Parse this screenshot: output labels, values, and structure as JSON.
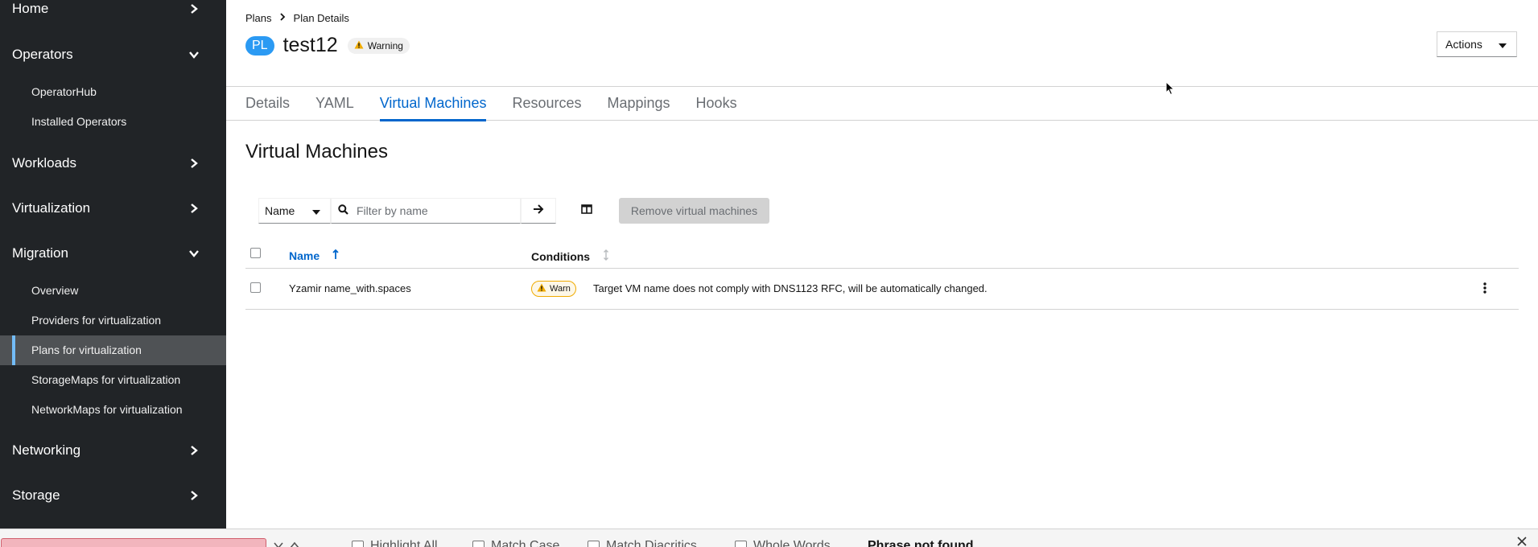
{
  "sidebar": {
    "items": [
      {
        "label": "Home",
        "expanded": false
      },
      {
        "label": "Operators",
        "expanded": true,
        "children": [
          "OperatorHub",
          "Installed Operators"
        ]
      },
      {
        "label": "Workloads",
        "expanded": false
      },
      {
        "label": "Virtualization",
        "expanded": false
      },
      {
        "label": "Migration",
        "expanded": true,
        "children": [
          "Overview",
          "Providers for virtualization",
          "Plans for virtualization",
          "StorageMaps for virtualization",
          "NetworkMaps for virtualization"
        ],
        "active_child": "Plans for virtualization"
      },
      {
        "label": "Networking",
        "expanded": false
      },
      {
        "label": "Storage",
        "expanded": false
      }
    ]
  },
  "breadcrumb": {
    "root": "Plans",
    "current": "Plan Details"
  },
  "header": {
    "badge": "PL",
    "title": "test12",
    "status": "Warning",
    "actions_label": "Actions"
  },
  "tabs": [
    "Details",
    "YAML",
    "Virtual Machines",
    "Resources",
    "Mappings",
    "Hooks"
  ],
  "active_tab": "Virtual Machines",
  "section_title": "Virtual Machines",
  "toolbar": {
    "filter_select": "Name",
    "search_placeholder": "Filter by name",
    "remove_label": "Remove virtual machines"
  },
  "table": {
    "columns": [
      "Name",
      "Conditions"
    ],
    "rows": [
      {
        "name": "Yzamir name_with.spaces",
        "condition": "Warn",
        "message": "Target VM name does not comply with DNS1123 RFC, will be automatically changed."
      }
    ]
  },
  "findbar": {
    "options": [
      "Highlight All",
      "Match Case",
      "Match Diacritics",
      "Whole Words"
    ],
    "status": "Phrase not found"
  },
  "colors": {
    "sidebar_bg": "#212427",
    "accent": "#0066cc",
    "warning": "#f0ab00",
    "badge_blue": "#2b9af3"
  }
}
